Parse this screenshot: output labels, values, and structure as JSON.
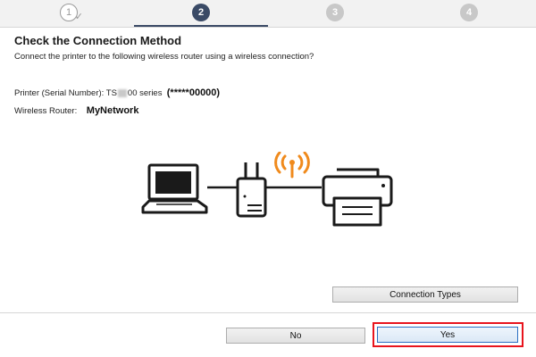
{
  "steps": {
    "items": [
      {
        "label": "1",
        "state": "done"
      },
      {
        "label": "2",
        "state": "current"
      },
      {
        "label": "3",
        "state": "pending"
      },
      {
        "label": "4",
        "state": "pending"
      }
    ],
    "done_check": "✓"
  },
  "page": {
    "title": "Check the Connection Method",
    "subtitle": "Connect the printer to the following wireless router using a wireless connection?"
  },
  "printer": {
    "label": "Printer (Serial Number):",
    "model_prefix": "TS",
    "model_suffix": "00 series",
    "serial": "(*****00000)"
  },
  "router": {
    "label": "Wireless Router:",
    "name": "MyNetwork"
  },
  "diagram": {
    "icons": [
      "laptop-icon",
      "router-icon",
      "wifi-signal-icon",
      "printer-icon"
    ],
    "wifi_color": "#f08a1c",
    "line_color": "#1a1a1a"
  },
  "buttons": {
    "connection_types": "Connection Types",
    "no": "No",
    "yes": "Yes"
  },
  "colors": {
    "current_step": "#3a4a66",
    "pending_step": "#c8c8c8",
    "highlight": "#e8141d",
    "focus_border": "#2b6fc2"
  }
}
